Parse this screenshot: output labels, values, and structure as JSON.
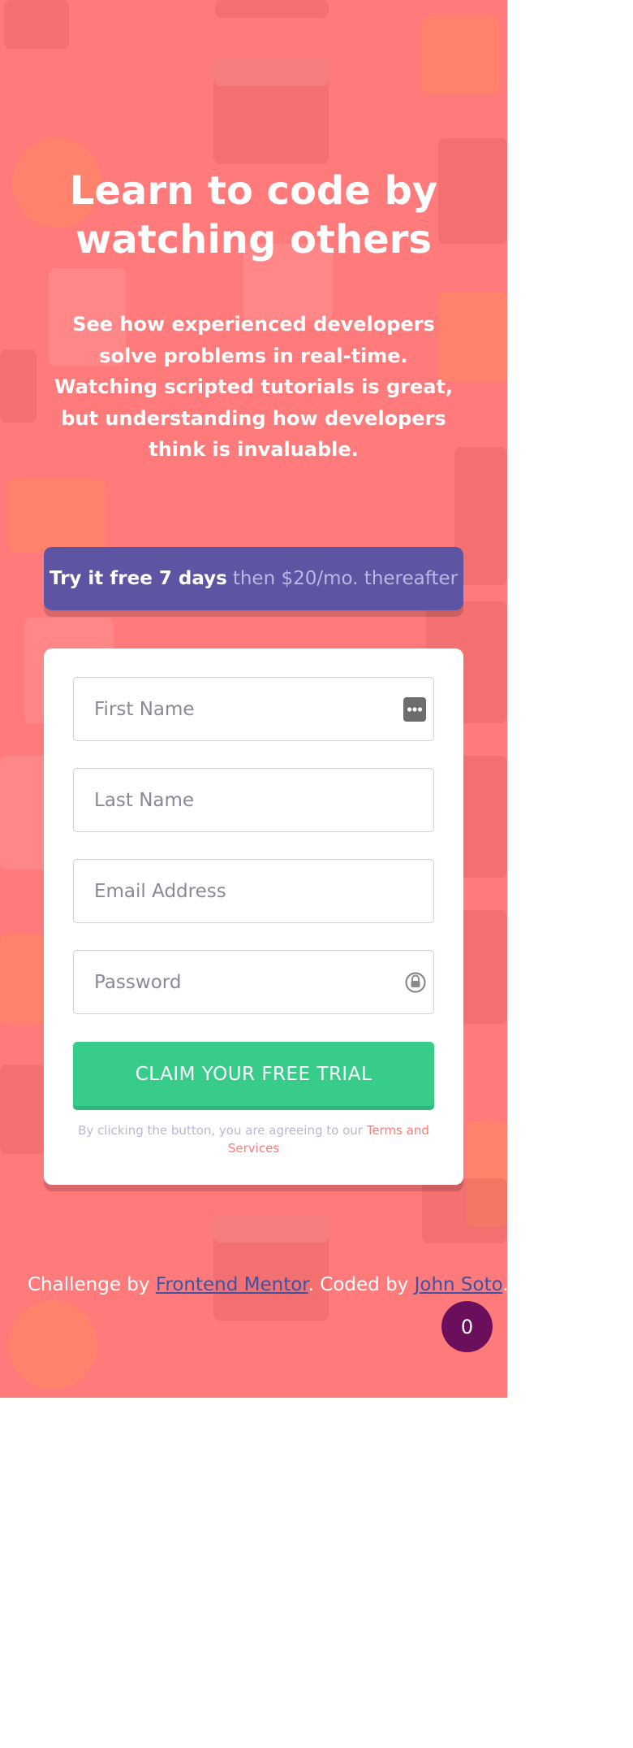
{
  "hero": {
    "headline": "Learn to code by watching others",
    "description": "See how experienced developers solve problems in real-time. Watching scripted tutorials is great, but understanding how developers think is invaluable."
  },
  "promo": {
    "strong": "Try it free 7 days",
    "muted": "then $20/mo. thereafter"
  },
  "form": {
    "first_name_placeholder": "First Name",
    "last_name_placeholder": "Last Name",
    "email_placeholder": "Email Address",
    "password_placeholder": "Password",
    "first_name_icon": "password-manager-dots-icon",
    "password_icon": "password-lock-icon",
    "submit_label": "CLAIM YOUR FREE TRIAL",
    "terms_prefix": "By clicking the button, you are agreeing to our ",
    "terms_link": "Terms and Services"
  },
  "footer": {
    "prefix": "Challenge by ",
    "mentor_link": "Frontend Mentor",
    "middle": ". Coded by ",
    "author_link": "John Soto",
    "suffix": "."
  },
  "badge": {
    "count": "0"
  },
  "colors": {
    "background": "#ff7a7a",
    "promo": "#5e54a4",
    "submit": "#38cc8b",
    "badge": "#6b0e5c",
    "link": "#3e52a3"
  }
}
